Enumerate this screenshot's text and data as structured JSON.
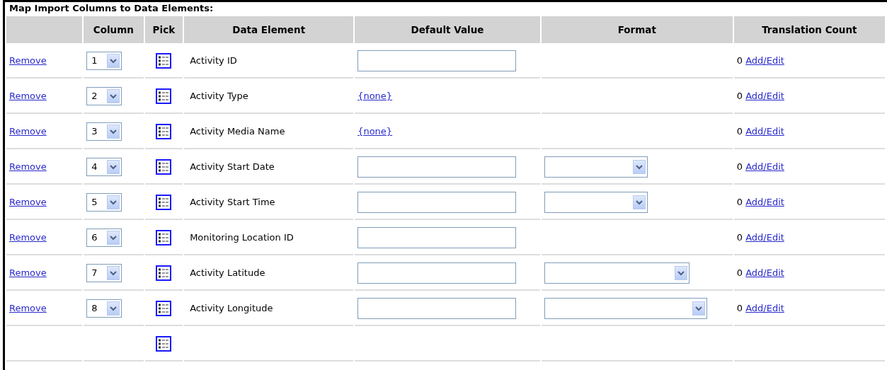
{
  "title": "Map Import Columns to Data Elements:",
  "columns": [
    "Column",
    "Pick",
    "Data Element",
    "Default Value",
    "Format",
    "Translation Count"
  ],
  "rows": [
    {
      "action": "Remove",
      "column": "1",
      "element": "Activity ID",
      "default": {
        "kind": "input"
      },
      "format": {
        "kind": "none"
      },
      "count": "0",
      "link": "Add/Edit"
    },
    {
      "action": "Remove",
      "column": "2",
      "element": "Activity Type",
      "default": {
        "kind": "link",
        "text": "{none}"
      },
      "format": {
        "kind": "none"
      },
      "count": "0",
      "link": "Add/Edit"
    },
    {
      "action": "Remove",
      "column": "3",
      "element": "Activity Media Name",
      "default": {
        "kind": "link",
        "text": "{none}"
      },
      "format": {
        "kind": "none"
      },
      "count": "0",
      "link": "Add/Edit"
    },
    {
      "action": "Remove",
      "column": "4",
      "element": "Activity Start Date",
      "default": {
        "kind": "input"
      },
      "format": {
        "kind": "short-select"
      },
      "count": "0",
      "link": "Add/Edit"
    },
    {
      "action": "Remove",
      "column": "5",
      "element": "Activity Start Time",
      "default": {
        "kind": "input"
      },
      "format": {
        "kind": "short-select"
      },
      "count": "0",
      "link": "Add/Edit"
    },
    {
      "action": "Remove",
      "column": "6",
      "element": "Monitoring Location ID",
      "default": {
        "kind": "input"
      },
      "format": {
        "kind": "none"
      },
      "count": "0",
      "link": "Add/Edit"
    },
    {
      "action": "Remove",
      "column": "7",
      "element": "Activity Latitude",
      "default": {
        "kind": "input"
      },
      "format": {
        "kind": "wide-select"
      },
      "count": "0",
      "link": "Add/Edit"
    },
    {
      "action": "Remove",
      "column": "8",
      "element": "Activity Longitude",
      "default": {
        "kind": "input"
      },
      "format": {
        "kind": "wider-select"
      },
      "count": "0",
      "link": "Add/Edit"
    }
  ],
  "new_row": {
    "pick": true
  }
}
